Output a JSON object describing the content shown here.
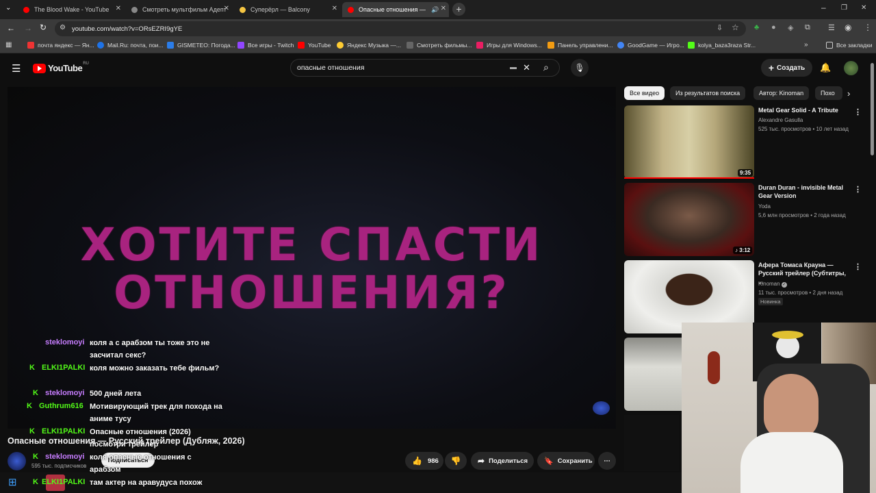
{
  "browser": {
    "tabs": [
      {
        "title": "The Blood Wake - YouTube",
        "color": "#ff0000"
      },
      {
        "title": "Смотреть мультфильм Адепт",
        "color": "#888888"
      },
      {
        "title": "Суперёрл — Balcony",
        "color": "#f5c542"
      },
      {
        "title": "Опасные отношения — Р",
        "color": "#ff0000"
      }
    ],
    "url": "youtube.com/watch?v=ORsEZRI9gYE",
    "bookmarks": [
      "почта яндекс — Ян...",
      "Mail.Ru: почта, пои...",
      "GISMETEO: Погода...",
      "Все игры - Twitch",
      "YouTube",
      "Яндекс Музыка —...",
      "Смотреть фильмы...",
      "Игры для Windows...",
      "Панель управлени...",
      "GoodGame — Игро...",
      "kolya_baza3raza Str..."
    ],
    "all_bookmarks": "Все закладки"
  },
  "youtube": {
    "logo": "YouTube",
    "region": "RU",
    "search_value": "опасные отношения",
    "create_label": "Создать"
  },
  "video": {
    "overlay_line1": "ХОТИТЕ СПАСТИ",
    "overlay_line2": "ОТНОШЕНИЯ?",
    "title": "Опасные отношения — Русский трейлер (Дубляж, 2026)",
    "subscribers": "595 тыс. подписчиков",
    "subscribe_label": "Подписаться",
    "likes": "986",
    "share_label": "Поделиться",
    "save_label": "Сохранить"
  },
  "filters": [
    "Все видео",
    "Из результатов поиска",
    "Автор: Kinoman",
    "Похо"
  ],
  "related": [
    {
      "title": "Metal Gear Solid - A Tribute",
      "channel": "Alexandre Gasulla",
      "meta": "525 тыс. просмотров • 10 лет назад",
      "duration": "9:35"
    },
    {
      "title": "Duran Duran - invisible Metal Gear Version",
      "channel": "Yoda",
      "meta": "5,6 млн просмотров • 2 года назад",
      "duration": "3:12"
    },
    {
      "title": "Афера Томаса Крауна — Русский трейлер (Субтитры, ...",
      "channel": "Kinoman",
      "meta": "11 тыс. просмотров • 2 дня назад",
      "badge": "Новинка"
    }
  ],
  "chat": [
    {
      "name": "steklomoyi",
      "color": "#c77dff",
      "text": "коля а с арабзом ты тоже это не засчитал секс?"
    },
    {
      "name": "ELKI1PALKI",
      "color": "#53fc18",
      "text": "коля можно заказать тебе фильм?"
    },
    {
      "name": "steklomoyi",
      "color": "#c77dff",
      "text": "500 дней лета"
    },
    {
      "name": "Guthrum616",
      "color": "#53fc18",
      "text": "Мотивирующий трек для похода на аниме тусу"
    },
    {
      "name": "ELKI1PALKI",
      "color": "#53fc18",
      "text": "Опасные отношения (2026) посмотри трейлер"
    },
    {
      "name": "steklomoyi",
      "color": "#c77dff",
      "text": "коля опасные отношения с арабзом"
    },
    {
      "name": "ELKI1PALKI",
      "color": "#53fc18",
      "text": "там актер на аравудуса похож"
    }
  ]
}
